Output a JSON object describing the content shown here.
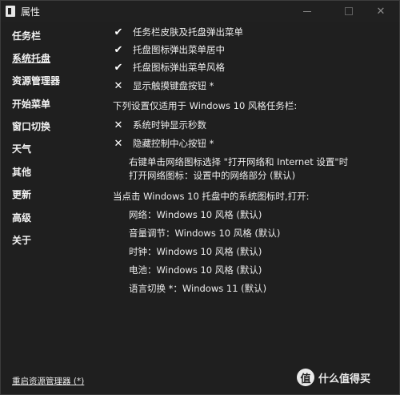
{
  "window": {
    "title": "属性",
    "minimize_icon": "minimize-icon",
    "maximize_icon": "maximize-icon",
    "close_icon": "close-icon",
    "close_glyph": "✕"
  },
  "sidebar": {
    "items": [
      {
        "label": "任务栏",
        "active": false
      },
      {
        "label": "系统托盘",
        "active": true
      },
      {
        "label": "资源管理器",
        "active": false
      },
      {
        "label": "开始菜单",
        "active": false
      },
      {
        "label": "窗口切换",
        "active": false
      },
      {
        "label": "天气",
        "active": false
      },
      {
        "label": "其他",
        "active": false
      },
      {
        "label": "更新",
        "active": false
      },
      {
        "label": "高级",
        "active": false
      },
      {
        "label": "关于",
        "active": false
      }
    ]
  },
  "main": {
    "options": [
      {
        "mark": "✔",
        "label": "任务栏皮肤及托盘弹出菜单",
        "checked": true
      },
      {
        "mark": "✔",
        "label": "托盘图标弹出菜单居中",
        "checked": true
      },
      {
        "mark": "✔",
        "label": "托盘图标弹出菜单风格",
        "checked": true
      },
      {
        "mark": "✕",
        "label": "显示触摸键盘按钮 *",
        "checked": false
      }
    ],
    "section_win10": "下列设置仅适用于 Windows 10 风格任务栏:",
    "win10_options": [
      {
        "mark": "✕",
        "label": "系统时钟显示秒数",
        "checked": false
      },
      {
        "mark": "✕",
        "label": "隐藏控制中心按钮 *",
        "checked": false
      }
    ],
    "network_right_click": "右键单击网络图标选择 \"打开网络和 Internet 设置\"时",
    "network_open": "打开网络图标：设置中的网络部分 (默认)",
    "section_tray_click": "当点击 Windows 10 托盘中的系统图标时,打开:",
    "tray_items": [
      "网络：Windows 10 风格 (默认)",
      "音量调节：Windows 10 风格 (默认)",
      "时钟：Windows 10 风格 (默认)",
      "电池：Windows 10 风格 (默认)",
      "语言切换 *：Windows 11 (默认)"
    ]
  },
  "footer": {
    "restart_link": "重启资源管理器 (*)"
  },
  "watermark": {
    "symbol": "值",
    "text": "什么值得买"
  }
}
